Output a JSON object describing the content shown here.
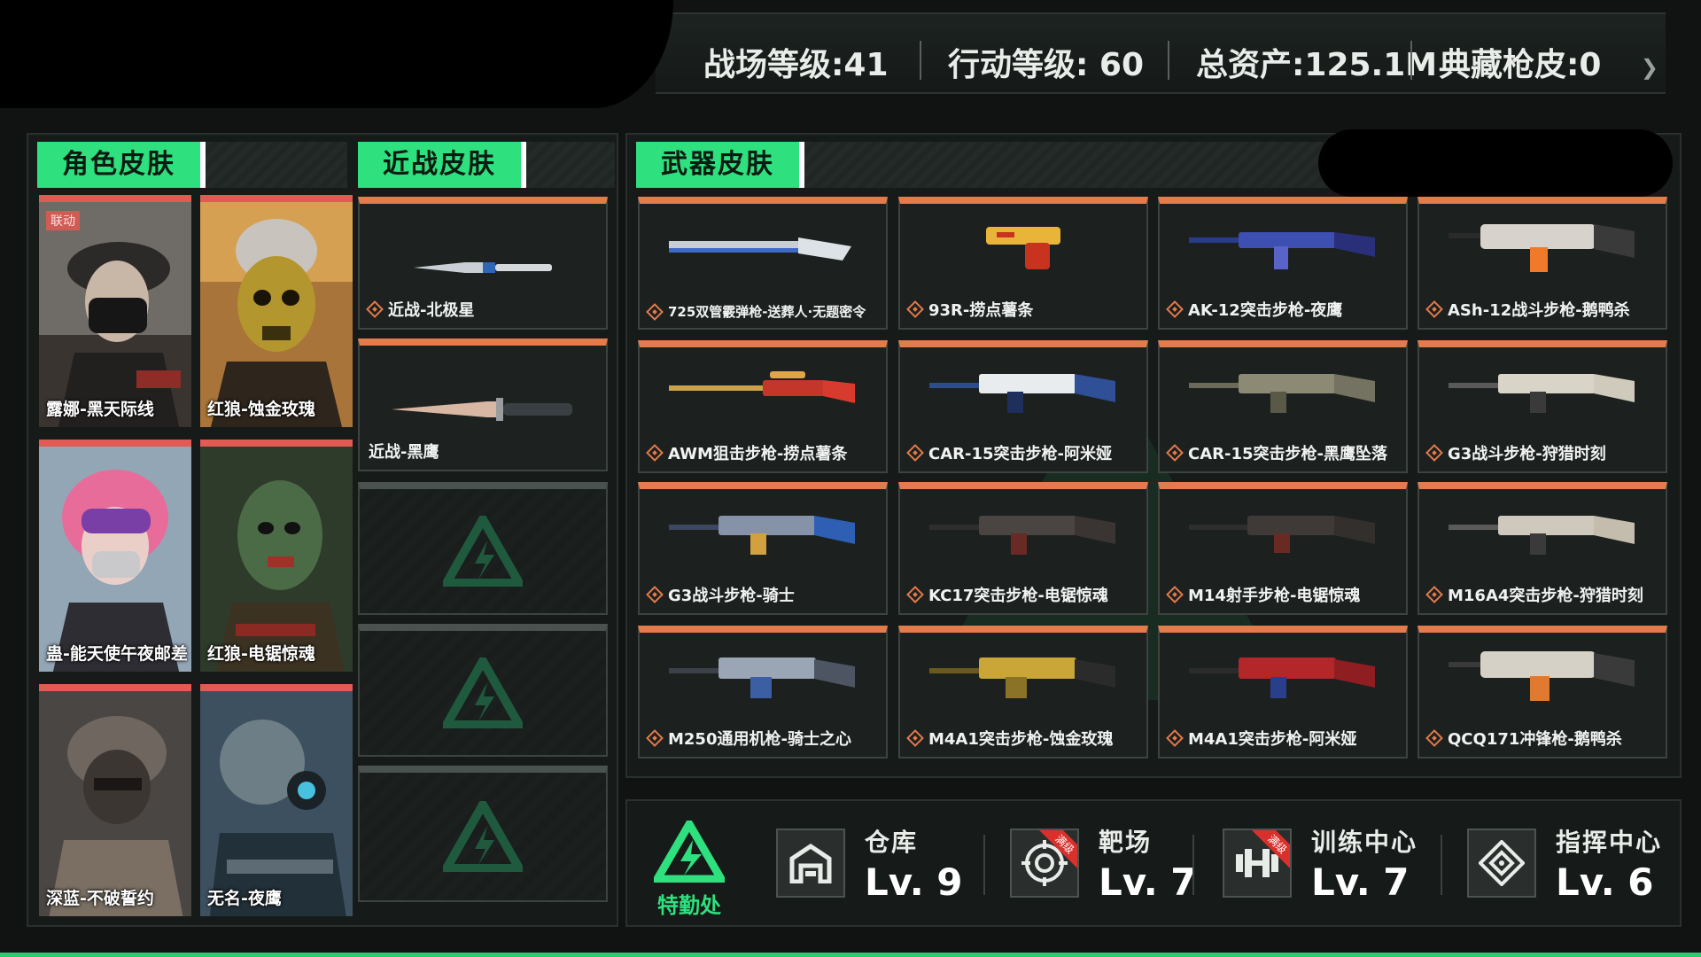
{
  "header": {
    "battlefield_level": "战场等级:41",
    "operation_level": "行动等级: 60",
    "total_assets": "总资产:125.1M",
    "collection_skins": "典藏枪皮:0"
  },
  "tabs": {
    "character": "角色皮肤",
    "melee": "近战皮肤",
    "weapon": "武器皮肤"
  },
  "character_skins": [
    {
      "name": "露娜-黑天际线",
      "badge": "联动"
    },
    {
      "name": "红狼-蚀金玫瑰"
    },
    {
      "name": "蛊-能天使午夜邮差"
    },
    {
      "name": "红狼-电锯惊魂"
    },
    {
      "name": "深蓝-不破誓约"
    },
    {
      "name": "无名-夜鹰"
    }
  ],
  "melee_skins": [
    {
      "name": "近战-北极星"
    },
    {
      "name": "近战-黑鹰"
    }
  ],
  "weapon_skins": [
    {
      "name": "725双管霰弹枪-送葬人·无题密令"
    },
    {
      "name": "93R-捞点薯条"
    },
    {
      "name": "AK-12突击步枪-夜鹰"
    },
    {
      "name": "ASh-12战斗步枪-鹅鸭杀"
    },
    {
      "name": "AWM狙击步枪-捞点薯条"
    },
    {
      "name": "CAR-15突击步枪-阿米娅"
    },
    {
      "name": "CAR-15突击步枪-黑鹰坠落"
    },
    {
      "name": "G3战斗步枪-狩猎时刻"
    },
    {
      "name": "G3战斗步枪-骑士"
    },
    {
      "name": "KC17突击步枪-电锯惊魂"
    },
    {
      "name": "M14射手步枪-电锯惊魂"
    },
    {
      "name": "M16A4突击步枪-狩猎时刻"
    },
    {
      "name": "M250通用机枪-骑士之心"
    },
    {
      "name": "M4A1突击步枪-蚀金玫瑰"
    },
    {
      "name": "M4A1突击步枪-阿米娅"
    },
    {
      "name": "QCQ171冲锋枪-鹅鸭杀"
    }
  ],
  "facilities": {
    "hq_label": "特勤处",
    "items": [
      {
        "name": "仓库",
        "level": "Lv. 9"
      },
      {
        "name": "靶场",
        "level": "Lv. 7",
        "badge": "满级"
      },
      {
        "name": "训练中心",
        "level": "Lv. 7",
        "badge": "满级"
      },
      {
        "name": "指挥中心",
        "level": "Lv. 6"
      }
    ]
  },
  "colors": {
    "accent_green": "#2ee07e",
    "orange": "#e37b4a",
    "red": "#e15a54"
  }
}
